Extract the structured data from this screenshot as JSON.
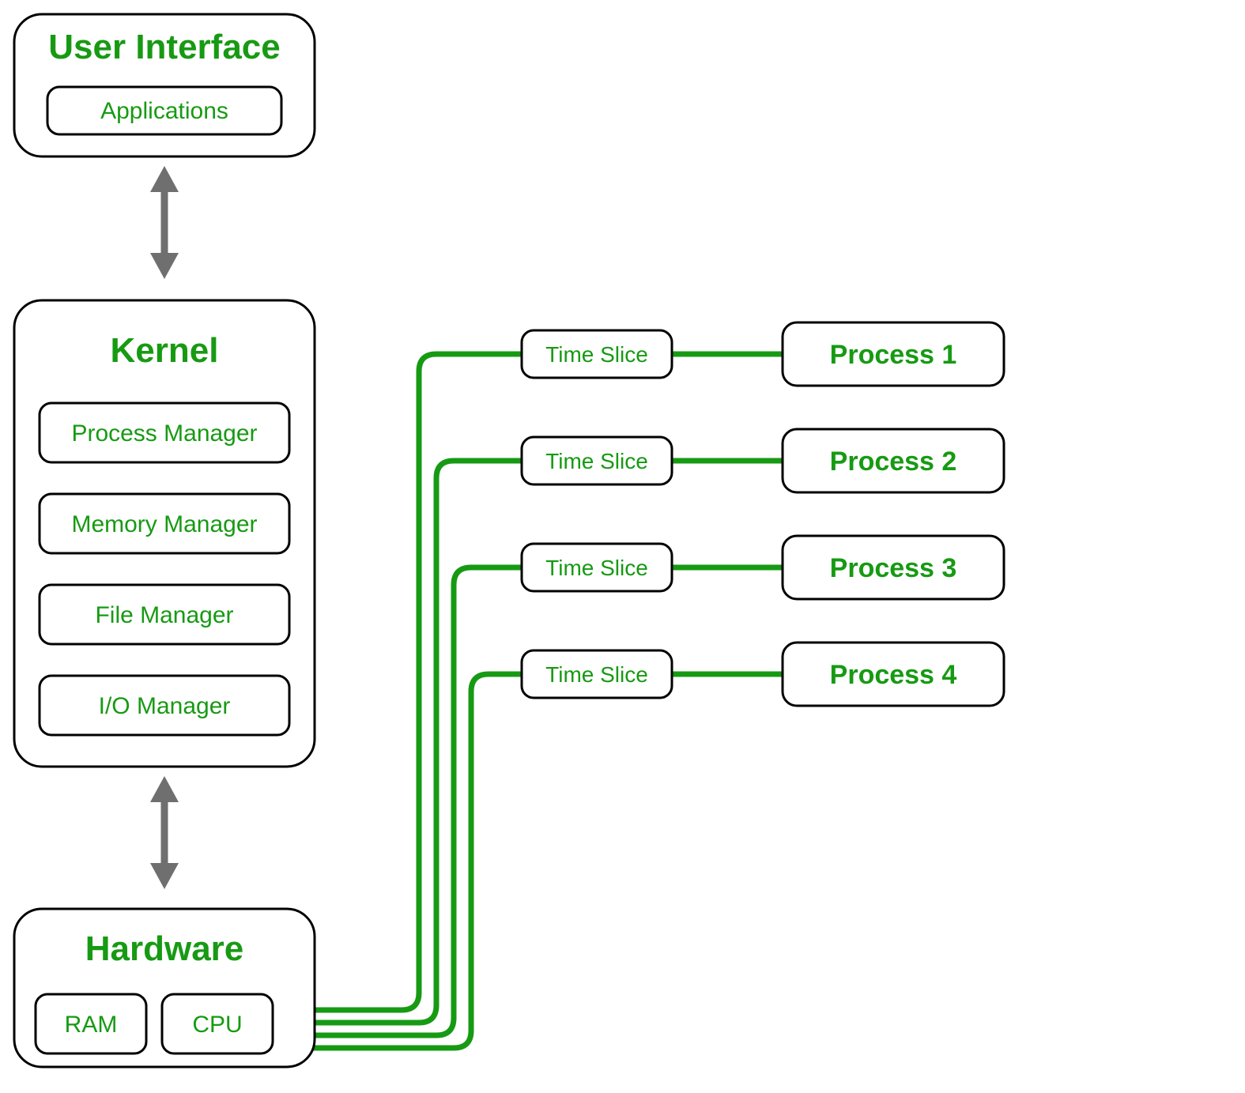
{
  "ui_layer": {
    "title": "User Interface",
    "items": [
      "Applications"
    ]
  },
  "kernel_layer": {
    "title": "Kernel",
    "items": [
      "Process  Manager",
      "Memory  Manager",
      "File  Manager",
      "I/O  Manager"
    ]
  },
  "hardware_layer": {
    "title": "Hardware",
    "items": [
      "RAM",
      "CPU"
    ]
  },
  "time_slices": [
    "Time Slice",
    "Time Slice",
    "Time Slice",
    "Time Slice"
  ],
  "processes": [
    "Process 1",
    "Process 2",
    "Process 3",
    "Process 4"
  ]
}
